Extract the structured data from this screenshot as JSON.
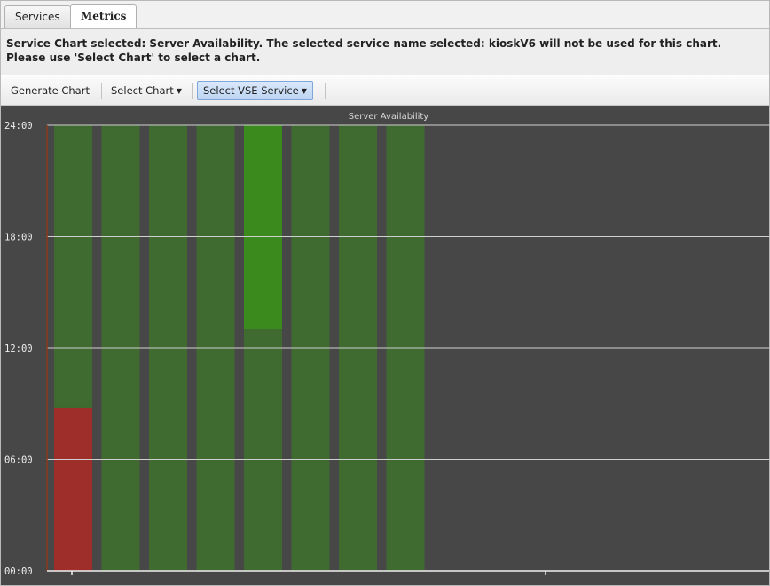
{
  "tabs": [
    {
      "label": "Services",
      "active": false
    },
    {
      "label": "Metrics",
      "active": true
    }
  ],
  "message": "Service Chart selected: Server Availability. The selected service name selected: kioskV6 will not be used for this chart. Please use 'Select Chart' to select a chart.",
  "toolbar": {
    "generate_label": "Generate Chart",
    "select_chart_label": "Select Chart",
    "select_service_label": "Select VSE Service"
  },
  "colors": {
    "background": "#474747",
    "available": "#3f6a30",
    "available_bright": "#3a8a1e",
    "unavailable": "#9e2e2a",
    "grid": "#d0d0d0"
  },
  "chart_data": {
    "type": "bar",
    "title": "Server Availability",
    "ylabel": "",
    "xlabel": "",
    "ylim": [
      0,
      24
    ],
    "y_ticks": [
      "00:00",
      "06:00",
      "12:00",
      "18:00",
      "24:00"
    ],
    "grid": true,
    "bars": [
      {
        "segments": [
          {
            "from": 0,
            "to": 8.8,
            "status": "unavailable"
          },
          {
            "from": 8.8,
            "to": 24,
            "status": "available"
          }
        ]
      },
      {
        "segments": [
          {
            "from": 0,
            "to": 24,
            "status": "available"
          }
        ]
      },
      {
        "segments": [
          {
            "from": 0,
            "to": 24,
            "status": "available"
          }
        ]
      },
      {
        "segments": [
          {
            "from": 0,
            "to": 24,
            "status": "available"
          }
        ]
      },
      {
        "segments": [
          {
            "from": 0,
            "to": 13,
            "status": "available"
          },
          {
            "from": 13,
            "to": 24,
            "status": "available_bright"
          }
        ]
      },
      {
        "segments": [
          {
            "from": 0,
            "to": 24,
            "status": "available"
          }
        ]
      },
      {
        "segments": [
          {
            "from": 0,
            "to": 24,
            "status": "available"
          }
        ]
      },
      {
        "segments": [
          {
            "from": 0,
            "to": 24,
            "status": "available"
          }
        ]
      }
    ]
  }
}
